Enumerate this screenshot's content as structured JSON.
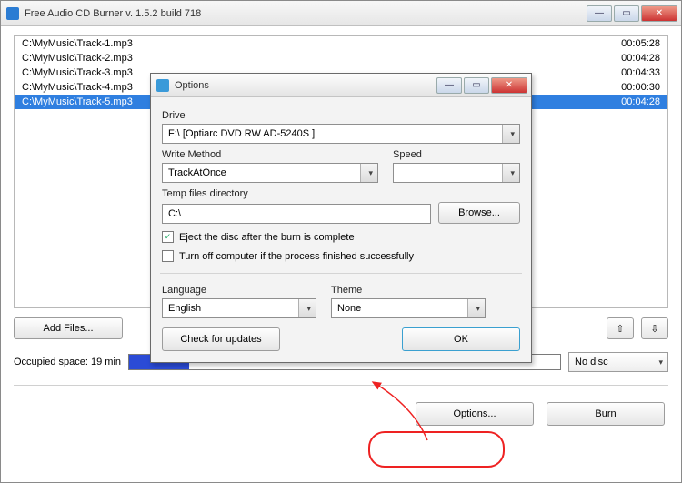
{
  "main": {
    "title": "Free Audio CD Burner  v. 1.5.2 build 718",
    "files": [
      {
        "path": "C:\\MyMusic\\Track-1.mp3",
        "dur": "00:05:28"
      },
      {
        "path": "C:\\MyMusic\\Track-2.mp3",
        "dur": "00:04:28"
      },
      {
        "path": "C:\\MyMusic\\Track-3.mp3",
        "dur": "00:04:33"
      },
      {
        "path": "C:\\MyMusic\\Track-4.mp3",
        "dur": "00:00:30"
      },
      {
        "path": "C:\\MyMusic\\Track-5.mp3",
        "dur": "00:04:28"
      }
    ],
    "add_files": "Add Files...",
    "up_arrow": "⇧",
    "down_arrow": "⇩",
    "occupied_label": "Occupied space:  19 min",
    "disc_combo": "No disc",
    "options_btn": "Options...",
    "burn_btn": "Burn"
  },
  "dialog": {
    "title": "Options",
    "drive_label": "Drive",
    "drive_value": "F:\\ [Optiarc DVD RW AD-5240S ]",
    "write_method_label": "Write Method",
    "write_method_value": "TrackAtOnce",
    "speed_label": "Speed",
    "speed_value": "",
    "temp_label": "Temp files directory",
    "temp_value": "C:\\",
    "browse_btn": "Browse...",
    "eject_cb": "Eject the disc after the burn is complete",
    "turnoff_cb": "Turn off computer if the process finished successfully",
    "language_label": "Language",
    "language_value": "English",
    "theme_label": "Theme",
    "theme_value": "None",
    "check_updates": "Check for updates",
    "ok_btn": "OK"
  }
}
